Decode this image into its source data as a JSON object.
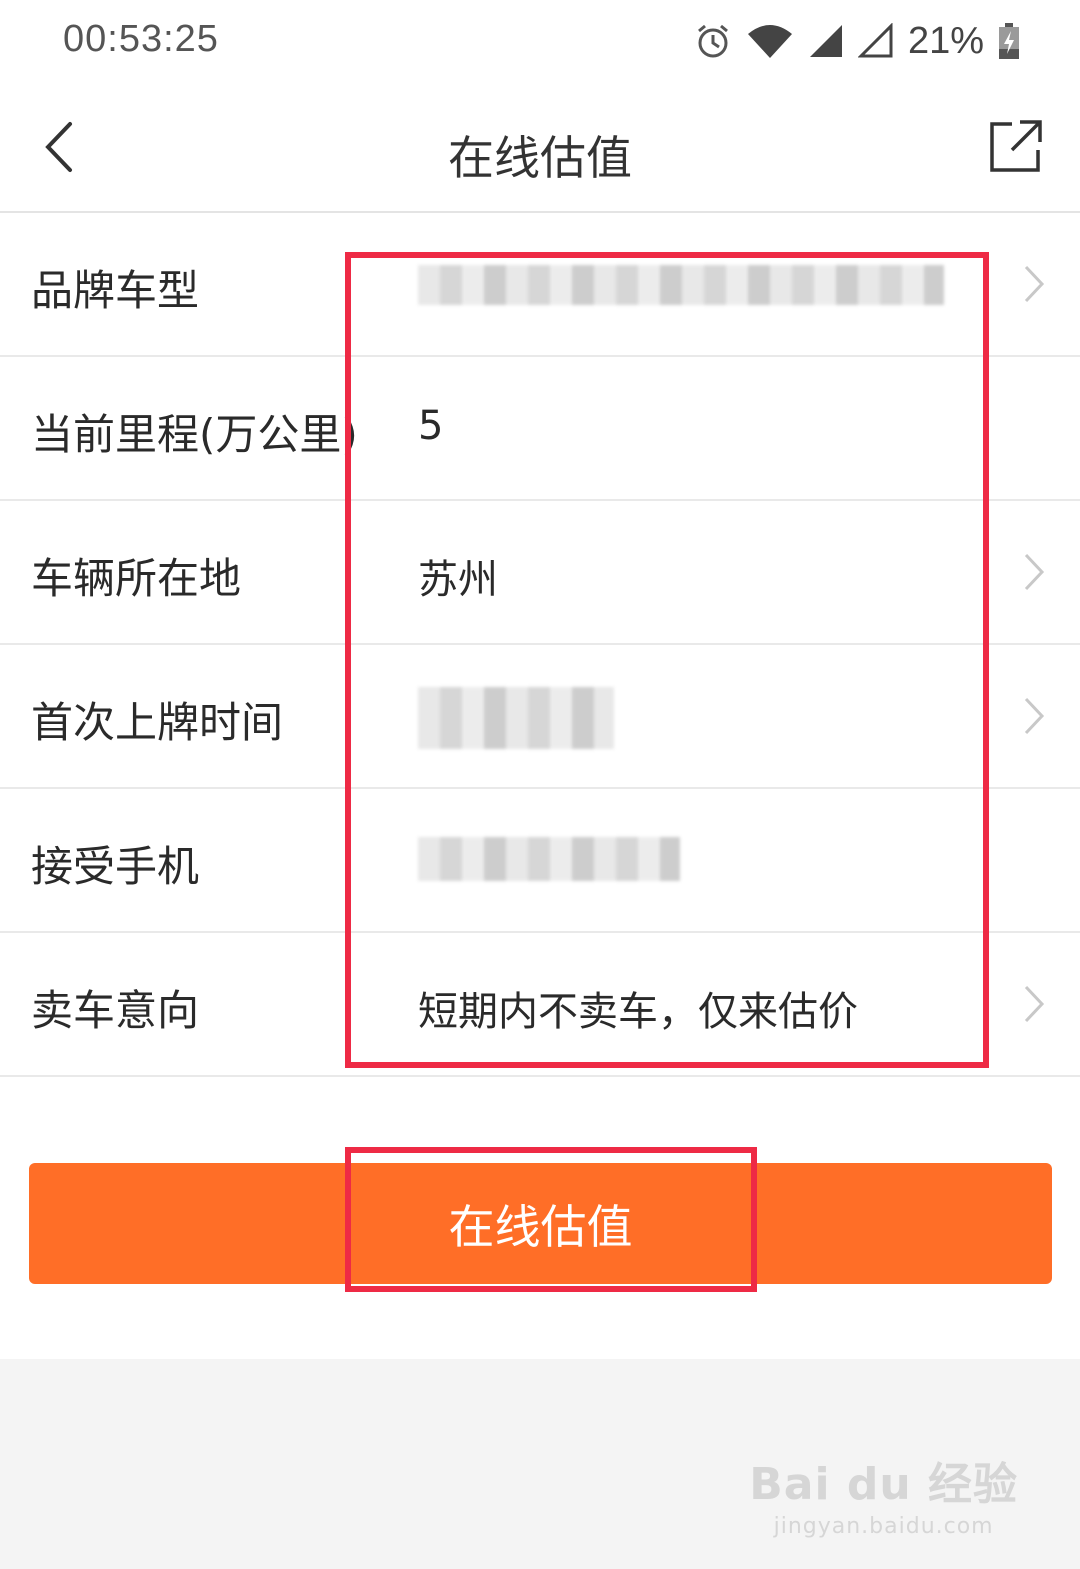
{
  "status_bar": {
    "time": "00:53:25",
    "battery_percent": "21%",
    "icons": [
      "alarm-icon",
      "wifi-icon",
      "signal-icon",
      "signal-empty-icon",
      "battery-charging-icon"
    ]
  },
  "header": {
    "title": "在线估值",
    "back_icon": "chevron-left-icon",
    "share_icon": "share-icon"
  },
  "form": {
    "rows": [
      {
        "label": "品牌车型",
        "value": "",
        "has_arrow": true
      },
      {
        "label": "当前里程(万公里)",
        "value": "5",
        "has_arrow": false
      },
      {
        "label": "车辆所在地",
        "value": "苏州",
        "has_arrow": true
      },
      {
        "label": "首次上牌时间",
        "value": "",
        "has_arrow": true
      },
      {
        "label": "接受手机",
        "value": "",
        "has_arrow": false
      },
      {
        "label": "卖车意向",
        "value": "短期内不卖车，仅来估价",
        "has_arrow": true
      }
    ]
  },
  "submit": {
    "label": "在线估值"
  },
  "colors": {
    "accent": "#ff6e27",
    "annotation": "#ee2a45",
    "divider": "#e9e9e9",
    "footer_bg": "#f4f4f4"
  },
  "watermark": {
    "main": "Bai du 经验",
    "sub": "jingyan.baidu.com"
  }
}
